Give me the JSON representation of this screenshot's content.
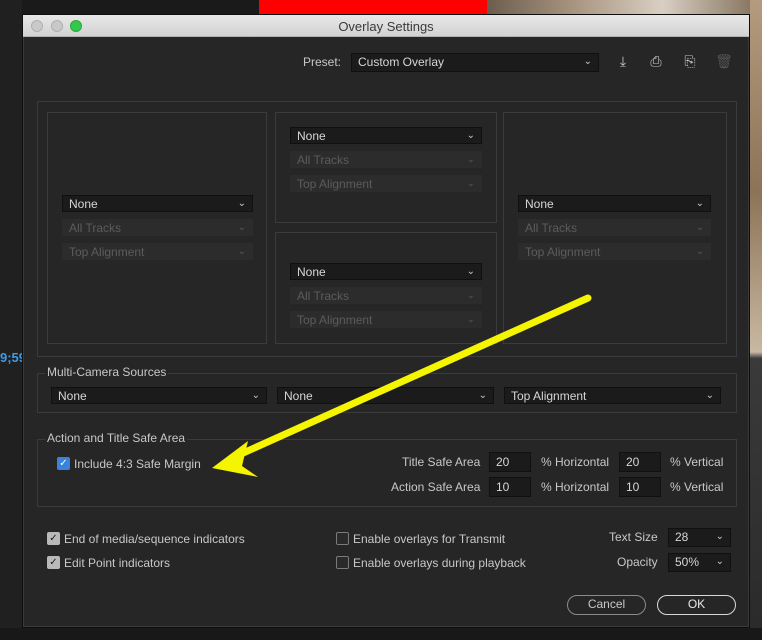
{
  "background": {
    "timecode": "9;59"
  },
  "dialog": {
    "title": "Overlay Settings",
    "preset_label": "Preset:",
    "preset_value": "Custom Overlay",
    "preset_icons": [
      "save-preset-icon",
      "import-preset-icon",
      "export-preset-icon",
      "delete-preset-icon"
    ]
  },
  "grid": {
    "left": {
      "source": "None",
      "tracks": "All Tracks",
      "alignment": "Top Alignment"
    },
    "top": {
      "source": "None",
      "tracks": "All Tracks",
      "alignment": "Top Alignment"
    },
    "bottom": {
      "source": "None",
      "tracks": "All Tracks",
      "alignment": "Top Alignment"
    },
    "right": {
      "source": "None",
      "tracks": "All Tracks",
      "alignment": "Top Alignment"
    }
  },
  "multicam": {
    "heading": "Multi-Camera Sources",
    "source1": "None",
    "source2": "None",
    "alignment": "Top Alignment"
  },
  "safe_area": {
    "heading": "Action and Title Safe Area",
    "include_margin_label": "Include 4:3 Safe Margin",
    "include_margin_checked": true,
    "title_label": "Title Safe Area",
    "title_h": "20",
    "title_v": "20",
    "action_label": "Action Safe Area",
    "action_h": "10",
    "action_v": "10",
    "h_unit": "% Horizontal",
    "v_unit": "% Vertical"
  },
  "options": {
    "end_media_label": "End of media/sequence indicators",
    "end_media_checked": true,
    "edit_point_label": "Edit Point indicators",
    "edit_point_checked": true,
    "transmit_label": "Enable overlays for Transmit",
    "transmit_checked": false,
    "playback_label": "Enable overlays during playback",
    "playback_checked": false,
    "text_size_label": "Text Size",
    "text_size_value": "28",
    "opacity_label": "Opacity",
    "opacity_value": "50%"
  },
  "buttons": {
    "cancel": "Cancel",
    "ok": "OK"
  },
  "annotation": {
    "arrow_color": "#f5f500"
  }
}
